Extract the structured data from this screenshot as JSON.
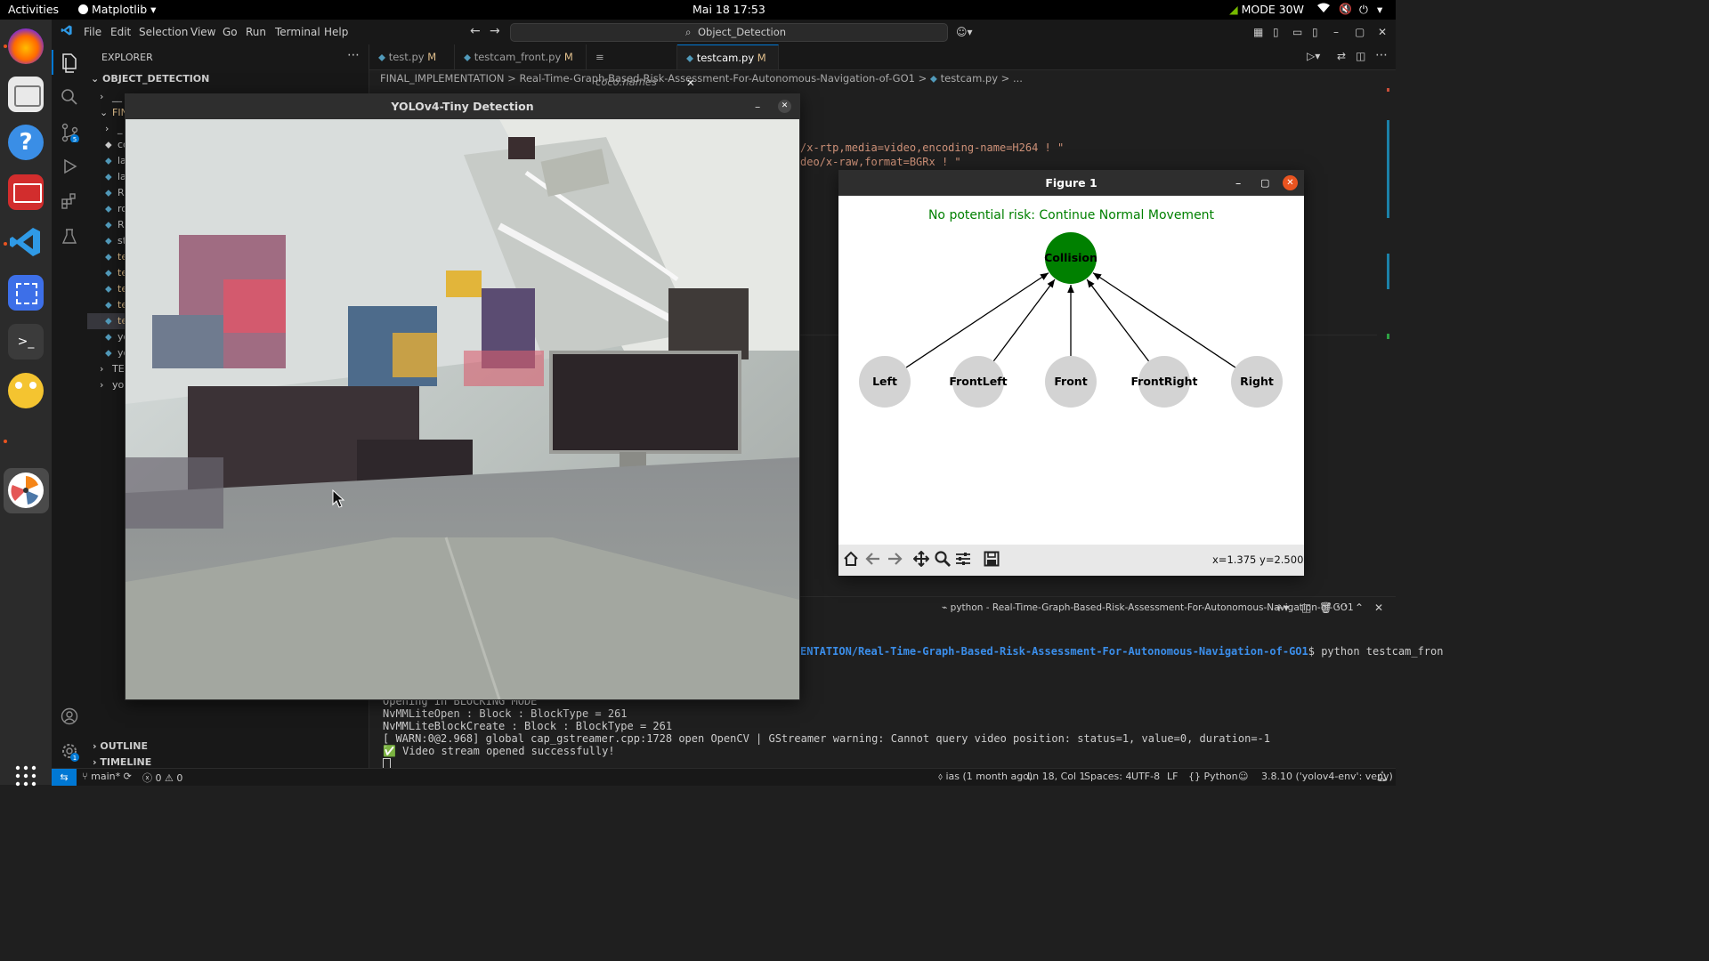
{
  "topbar": {
    "activities": "Activities",
    "app_name": "Matplotlib",
    "clock": "Mai 18  17:53",
    "power_mode": "MODE 30W"
  },
  "vscode": {
    "menu": [
      "File",
      "Edit",
      "Selection",
      "View",
      "Go",
      "Run",
      "Terminal",
      "Help"
    ],
    "search": "Object_Detection",
    "tabs": [
      {
        "label": "test.py",
        "badge": "M"
      },
      {
        "label": "testcam_front.py",
        "badge": "M"
      },
      {
        "label": "coco.names",
        "badge": ""
      },
      {
        "label": "testcam.py",
        "badge": "M"
      }
    ],
    "breadcrumb": [
      "FINAL_IMPLEMENTATION",
      "Real-Time-Graph-Based-Risk-Assessment-For-Autonomous-Navigation-of-GO1",
      "testcam.py",
      "..."
    ],
    "explorer": {
      "title": "EXPLORER",
      "section": "OBJECT_DETECTION",
      "items": [
        "__",
        "FIN",
        "_",
        "co",
        "la",
        "la",
        "R",
        "ro",
        "R",
        "st",
        "te",
        "te",
        "te",
        "te",
        "te",
        "yo",
        "yo",
        "TES",
        "yol"
      ],
      "outline": "OUTLINE",
      "timeline": "TIMELINE"
    },
    "code_lines": [
      "/x-rtp,media=video,encoding-name=H264 ! \"",
      "deo/x-raw,format=BGRx ! \""
    ],
    "terminal": {
      "tab_label": "python - Real-Time-Graph-Based-Risk-Assessment-For-Autonomous-Navigation-of-GO1",
      "path_fragment": "ENTATION/Real-Time-Graph-Based-Risk-Assessment-For-Autonomous-Navigation-of-GO1",
      "command": "$ python testcam_fron",
      "lines": [
        "Opening in BLOCKING MODE",
        "NvMMLiteOpen : Block : BlockType = 261",
        "NvMMLiteBlockCreate : Block : BlockType = 261",
        "[ WARN:0@2.968] global cap_gstreamer.cpp:1728 open OpenCV | GStreamer warning: Cannot query video position: status=1, value=0, duration=-1",
        "✅ Video stream opened successfully!"
      ]
    },
    "status": {
      "branch": "main*",
      "problems": "ⓧ 0 ⚠ 0",
      "blame": "ias (1 month ago)",
      "position": "Ln 18, Col 1",
      "spaces": "Spaces: 4",
      "encoding": "UTF-8",
      "eol": "LF",
      "language": "Python",
      "interpreter": "3.8.10 ('yolov4-env': venv)"
    }
  },
  "yolo_window": {
    "title": "YOLOv4-Tiny Detection"
  },
  "figure_window": {
    "title": "Figure 1",
    "status_message": "No potential risk: Continue Normal Movement",
    "coords": "x=1.375 y=2.500",
    "graph": {
      "nodes": [
        {
          "id": "collision",
          "label": "Collision",
          "fill": "#008000"
        },
        {
          "id": "left",
          "label": "Left",
          "fill": "#d3d3d3"
        },
        {
          "id": "frontleft",
          "label": "FrontLeft",
          "fill": "#d3d3d3"
        },
        {
          "id": "front",
          "label": "Front",
          "fill": "#d3d3d3"
        },
        {
          "id": "frontright",
          "label": "FrontRight",
          "fill": "#d3d3d3"
        },
        {
          "id": "right",
          "label": "Right",
          "fill": "#d3d3d3"
        }
      ],
      "edges": [
        [
          "left",
          "collision"
        ],
        [
          "frontleft",
          "collision"
        ],
        [
          "front",
          "collision"
        ],
        [
          "frontright",
          "collision"
        ],
        [
          "right",
          "collision"
        ]
      ]
    }
  },
  "colors": {
    "risk_ok_text": "#008000",
    "accent": "#0078d4"
  }
}
